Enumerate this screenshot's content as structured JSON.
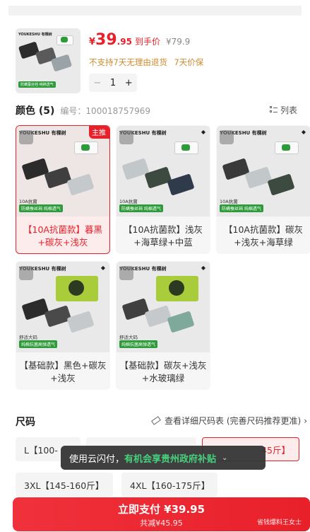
{
  "product": {
    "thumb_brand": "YOUKESHU 有棵树",
    "thumb_tag": "防螨蚕丝裆 纯棉透气",
    "price_symbol": "¥",
    "price_int": "39",
    "price_dec": ".95",
    "price_label": "到手价",
    "original_price": "¥79.9",
    "policies": [
      "不支持7天无理由退货",
      "7天价保"
    ],
    "quantity": "1",
    "minus": "−",
    "plus": "+"
  },
  "colors": {
    "title": "颜色 (5)",
    "code_label": "编号：100018757969",
    "list_toggle": "列表",
    "items": [
      {
        "label": "【10A抗菌款】暮黑+碳灰+浅灰",
        "brand": "YOUKESHU 有棵树",
        "badge": "主推",
        "line1": "10A抗菌",
        "tag": "防螨蚕丝裆 纯棉透气",
        "active": true
      },
      {
        "label": "【10A抗菌款】浅灰+海草绿+中蓝",
        "brand": "YOUKESHU 有棵树",
        "line1": "10A抗菌",
        "tag": "防螨蚕丝裆 纯棉透气",
        "active": false
      },
      {
        "label": "【10A抗菌款】碳灰+浅灰+海草绿",
        "brand": "YOUKESHU 有棵树",
        "line1": "10A抗菌",
        "tag": "防螨蚕丝裆 纯棉透气",
        "active": false
      },
      {
        "label": "【基础款】黑色+碳灰+浅灰",
        "brand": "YOUKESHU 有棵树",
        "line1": "舒适大码",
        "tag": "纯棉抗菌高弹透气",
        "active": false
      },
      {
        "label": "【基础款】碳灰+浅灰+水玻璃绿",
        "brand": "YOUKESHU 有棵树",
        "line1": "舒适大码",
        "tag": "纯棉抗菌高弹透气",
        "active": false
      }
    ]
  },
  "sizes": {
    "title": "尺码",
    "chart_link": "查看详细尺码表 (完善尺码推荐更准)",
    "items": [
      {
        "label": "L【100-",
        "active": false
      },
      {
        "label": "",
        "active": false
      },
      {
        "label": "45斤】",
        "active": true
      },
      {
        "label": "3XL【145-160斤】",
        "active": false
      },
      {
        "label": "4XL【160-175斤】",
        "active": false
      }
    ]
  },
  "toast": {
    "prefix": "使用云闪付，",
    "highlight": "有机会享贵州政府补贴"
  },
  "pay": {
    "main": "立即支付 ¥39.95",
    "sub": "共减¥45.95",
    "watermark": "省钱爆料王女士"
  },
  "colors_palette": {
    "accent": "#e8202a",
    "policy": "#d08a2c",
    "toast_highlight": "#46d07c"
  }
}
